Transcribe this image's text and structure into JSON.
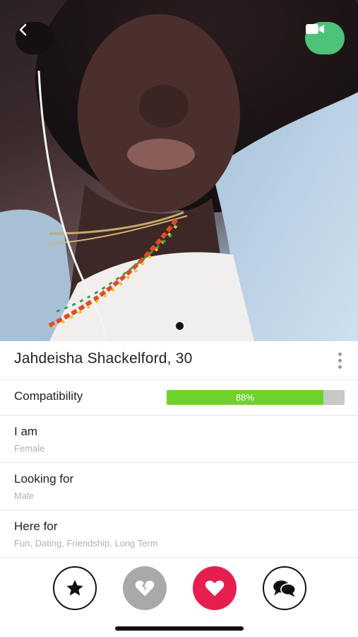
{
  "profile": {
    "name_age": "Jahdeisha Shackelford, 30",
    "photo_alt": "profile photo"
  },
  "compatibility": {
    "label": "Compatibility",
    "percent_text": "88%",
    "fraction": 0.88,
    "fill_color": "#6fd12c"
  },
  "details": [
    {
      "title": "I am",
      "value": "Female"
    },
    {
      "title": "Looking for",
      "value": "Male"
    },
    {
      "title": "Here for",
      "value": "Fun, Dating, Friendship, Long Term"
    }
  ],
  "icons": {
    "back": "chevron-left-icon",
    "video": "video-camera-icon",
    "more": "more-vertical-icon",
    "star": "star-icon",
    "pass": "broken-heart-icon",
    "like": "heart-icon",
    "chat": "chat-bubbles-icon"
  },
  "colors": {
    "video_button": "#4cc27a",
    "like_button": "#e61f50",
    "pass_button": "#a9a9a9"
  }
}
